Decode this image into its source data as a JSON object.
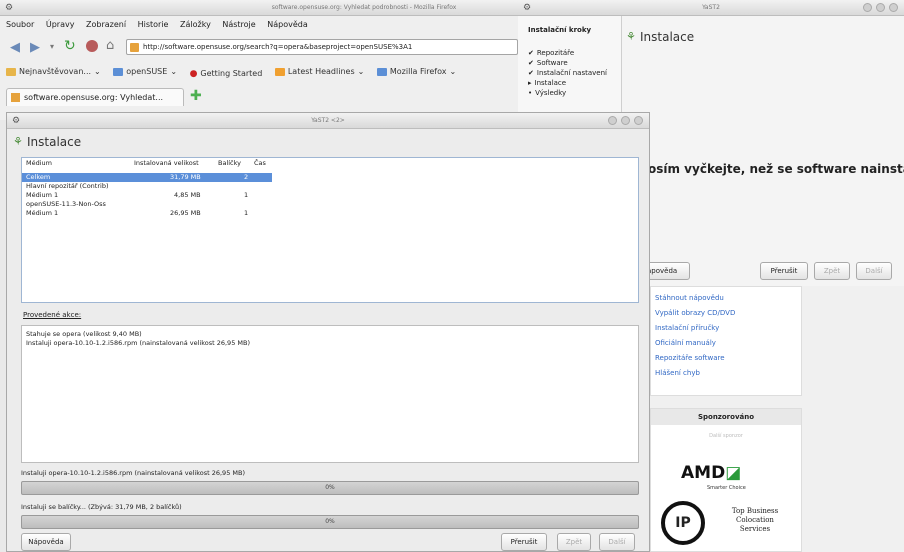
{
  "browser": {
    "title": "software.opensuse.org: Vyhledat podrobnosti - Mozilla Firefox",
    "menu": [
      "Soubor",
      "Úpravy",
      "Zobrazení",
      "Historie",
      "Záložky",
      "Nástroje",
      "Nápověda"
    ],
    "url": "http://software.opensuse.org/search?q=opera&baseproject=openSUSE%3A1",
    "bookmarks": [
      "Nejnavštěvovan...",
      "openSUSE",
      "Getting Started",
      "Latest Headlines",
      "Mozilla Firefox"
    ],
    "tab": "software.opensuse.org: Vyhledat...",
    "sidebar_links": [
      "Stáhnout nápovědu",
      "Vypálit obrazy CD/DVD",
      "Instalační příručky",
      "Oficiální manuály",
      "Repozitáře software",
      "Hlášení chyb"
    ],
    "sponsor_title": "Sponzorováno",
    "sponsor_sub": "Další sponzor",
    "amd_tagline": "Smarter Choice",
    "ip_text": "Top Business Colocation Services"
  },
  "yast_back": {
    "title": "YaST2",
    "heading": "Instalace",
    "message": "osím vyčkejte, než se software nainstalu",
    "help_label": "apověda",
    "abort_label": "Přerušit",
    "back_label": "Zpět",
    "next_label": "Další",
    "steps_title": "Instalační kroky",
    "steps": [
      {
        "mark": "✔",
        "label": "Repozitáře"
      },
      {
        "mark": "✔",
        "label": "Software"
      },
      {
        "mark": "✔",
        "label": "Instalační nastavení"
      },
      {
        "mark": "▸",
        "label": "Instalace"
      },
      {
        "mark": "•",
        "label": "Výsledky"
      }
    ]
  },
  "yast_front": {
    "title": "YaST2 <2>",
    "heading": "Instalace",
    "columns": [
      "Médium",
      "Instalovaná velikost",
      "Balíčky",
      "Čas"
    ],
    "rows": [
      {
        "medium": "Celkem",
        "size": "31,79 MB",
        "packages": "2",
        "time": "",
        "selected": true
      },
      {
        "medium": "Hlavní repozitář (Contrib)",
        "size": "",
        "packages": "",
        "time": "",
        "selected": false
      },
      {
        "medium": "Médium 1",
        "size": "4,85 MB",
        "packages": "1",
        "time": "",
        "selected": false
      },
      {
        "medium": "openSUSE-11.3-Non-Oss",
        "size": "",
        "packages": "",
        "time": "",
        "selected": false
      },
      {
        "medium": "Médium 1",
        "size": "26,95 MB",
        "packages": "1",
        "time": "",
        "selected": false
      }
    ],
    "actions_label": "Provedené akce:",
    "log": [
      "Stahuje se opera (velikost 9,40 MB)",
      "Instaluji opera-10.10-1.2.i586.rpm (nainstalovaná velikost 26,95 MB)"
    ],
    "progress1_label": "Instaluji opera-10.10-1.2.i586.rpm (nainstalovaná velikost 26,95 MB)",
    "progress1_value": "0%",
    "progress2_label": "Instaluji se balíčky... (Zbývá: 31,79 MB, 2 balíčků)",
    "progress2_value": "0%",
    "help_label": "Nápověda",
    "abort_label": "Přerušit",
    "back_label": "Zpět",
    "next_label": "Další"
  }
}
